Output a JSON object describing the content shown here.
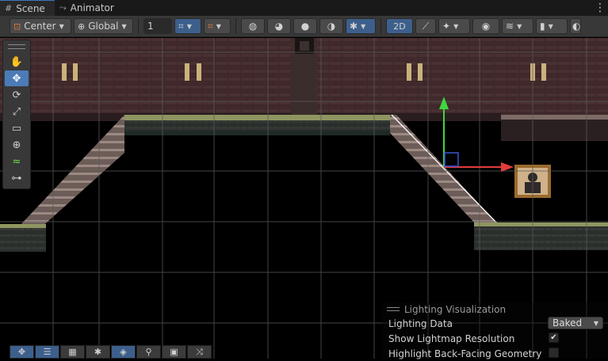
{
  "tabs": [
    {
      "label": "Scene",
      "icon": "grid-icon",
      "active": true
    },
    {
      "label": "Animator",
      "icon": "animator-icon",
      "active": false
    }
  ],
  "toolbar": {
    "pivot_label": "Center",
    "space_label": "Global",
    "grid_snap_value": "1",
    "mode_2d_label": "2D"
  },
  "tools": [
    "hand-tool",
    "move-tool",
    "rotate-tool",
    "scale-tool",
    "rect-tool",
    "transform-tool",
    "custom-tool-1",
    "custom-tool-2"
  ],
  "overlays": [
    "move",
    "inspector",
    "tilemap",
    "bug",
    "layers",
    "search",
    "camera",
    "shuffle"
  ],
  "lighting_panel": {
    "title": "Lighting Visualization",
    "rows": [
      {
        "label": "Lighting Data",
        "type": "dropdown",
        "value": "Baked"
      },
      {
        "label": "Show Lightmap Resolution",
        "type": "checkbox",
        "checked": true
      },
      {
        "label": "Highlight Back-Facing Geometry",
        "type": "checkbox",
        "checked": false
      }
    ]
  },
  "colors": {
    "accent": "#4c7bb8",
    "gizmo_x": "#e23c3c",
    "gizmo_y": "#3fd63f",
    "gizmo_z": "#3b55d4"
  }
}
